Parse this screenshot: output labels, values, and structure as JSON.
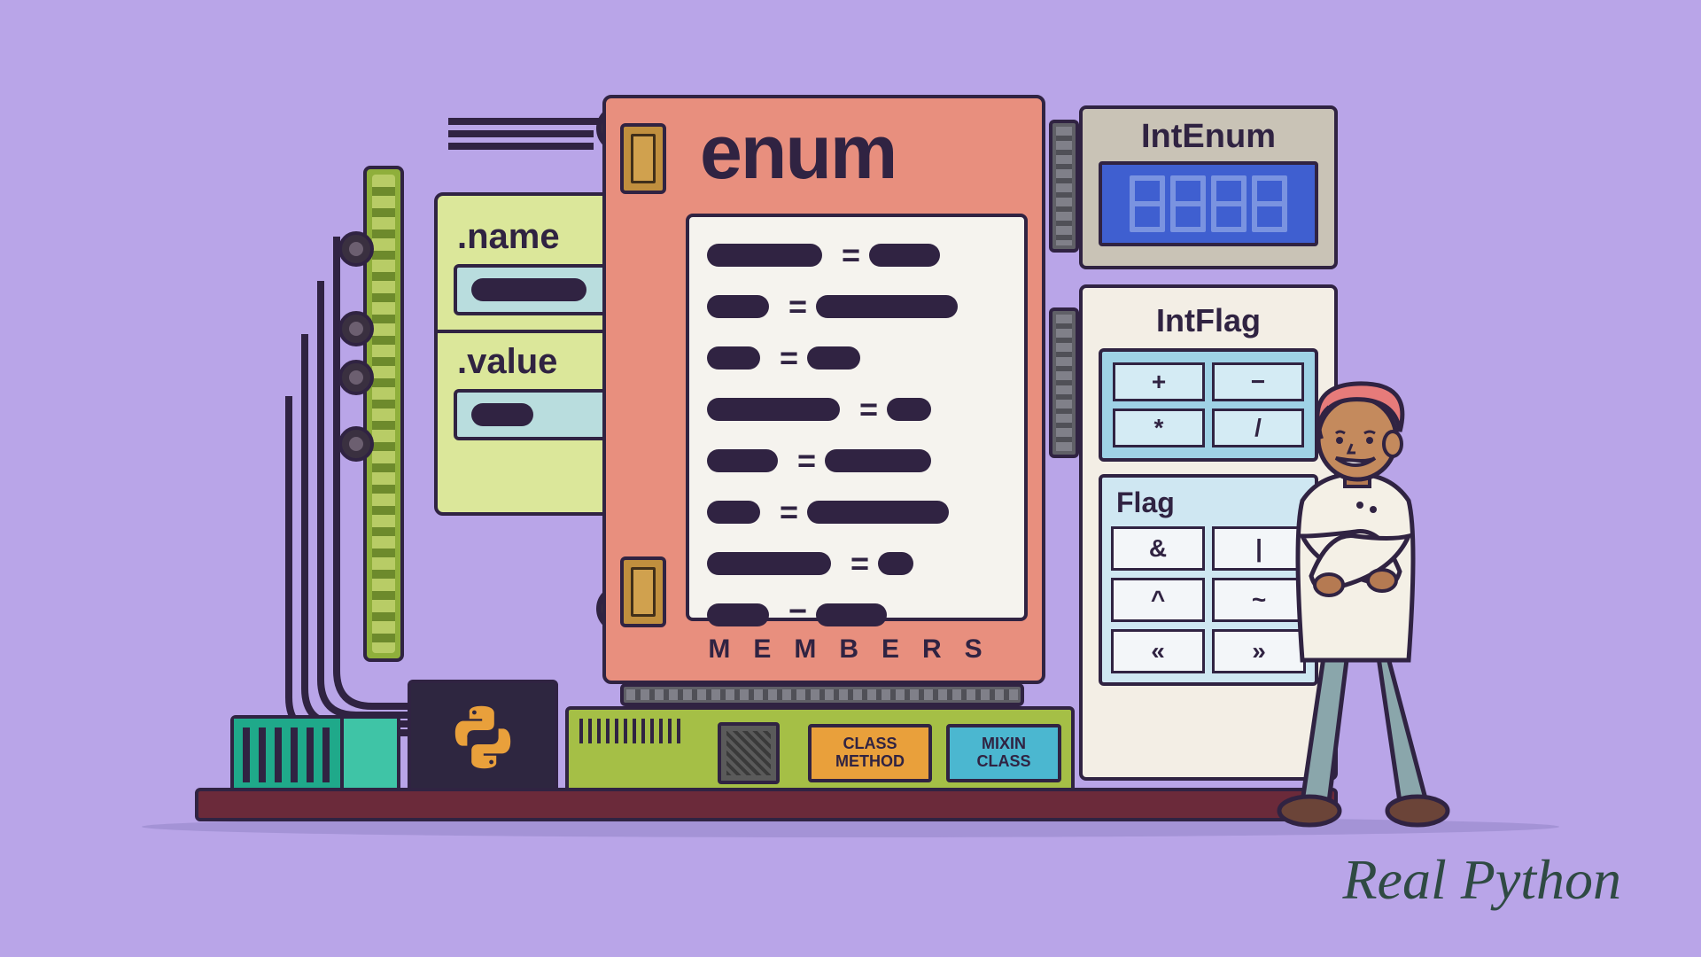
{
  "nv": {
    "name_label": ".name",
    "value_label": ".value"
  },
  "enum": {
    "title": "enum",
    "members_label": "MEMBERS"
  },
  "intenum": {
    "label": "IntEnum"
  },
  "intflag": {
    "label": "IntFlag",
    "keys": [
      "+",
      "−",
      "*",
      "/"
    ]
  },
  "flag": {
    "label": "Flag",
    "keys": [
      "&",
      "|",
      "^",
      "~",
      "«",
      "»"
    ]
  },
  "bottom": {
    "class_method_l1": "CLASS",
    "class_method_l2": "METHOD",
    "mixin_l1": "MIXIN",
    "mixin_l2": "CLASS"
  },
  "logo": "Real Python"
}
